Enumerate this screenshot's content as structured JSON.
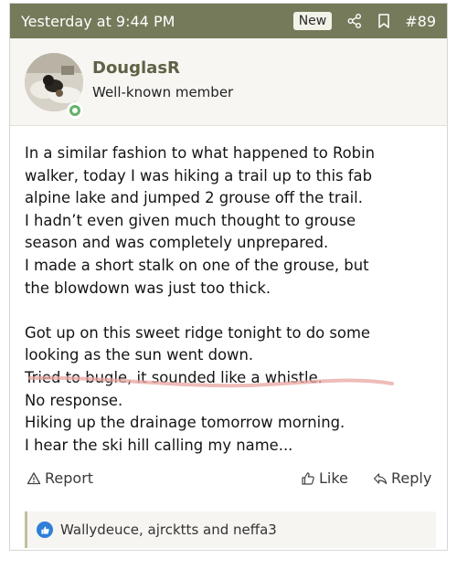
{
  "header": {
    "timestamp": "Yesterday at 9:44 PM",
    "new_badge": "New",
    "post_number": "#89",
    "share_icon": "share-icon",
    "bookmark_icon": "bookmark-icon"
  },
  "author": {
    "name": "DouglasR",
    "role": "Well-known member",
    "online": true
  },
  "message": {
    "lines": [
      "In a similar fashion to what happened to Robin",
      "walker, today I was hiking a trail up to this fab",
      "alpine lake and jumped 2 grouse off the trail.",
      "I hadn’t even given much thought to grouse",
      "season and was completely unprepared.",
      "I made a short stalk on one of the grouse, but",
      "the blowdown was just too thick.",
      "",
      "Got up on this sweet ridge tonight to do some",
      "looking as the sun went down.",
      "Tried to bugle, it sounded like a whistle.",
      "No response.",
      "Hiking up the drainage tomorrow morning.",
      "I hear the ski hill calling my name..."
    ]
  },
  "actions": {
    "report": "Report",
    "like": "Like",
    "reply": "Reply"
  },
  "reactions": {
    "text": "Wallydeuce, ajrcktts and neffa3"
  },
  "colors": {
    "header_bg": "#757a5a",
    "username": "#5f6246",
    "online": "#63b26b",
    "like_badge": "#2f7fd9",
    "annotation_stroke": "#e8a6a0"
  }
}
